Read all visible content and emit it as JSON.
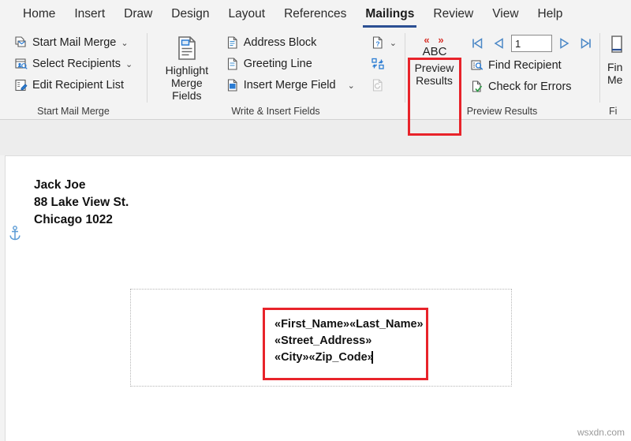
{
  "tabs": [
    {
      "label": "Home",
      "active": false
    },
    {
      "label": "Insert",
      "active": false
    },
    {
      "label": "Draw",
      "active": false
    },
    {
      "label": "Design",
      "active": false
    },
    {
      "label": "Layout",
      "active": false
    },
    {
      "label": "References",
      "active": false
    },
    {
      "label": "Mailings",
      "active": true
    },
    {
      "label": "Review",
      "active": false
    },
    {
      "label": "View",
      "active": false
    },
    {
      "label": "Help",
      "active": false
    }
  ],
  "ribbon": {
    "groups": {
      "start_mail_merge": {
        "label": "Start Mail Merge",
        "commands": [
          {
            "name": "start-mail-merge",
            "label": "Start Mail Merge",
            "icon": "envelope-document-icon",
            "dropdown": true
          },
          {
            "name": "select-recipients",
            "label": "Select Recipients",
            "icon": "recipients-list-icon",
            "dropdown": true
          },
          {
            "name": "edit-recipient-list",
            "label": "Edit Recipient List",
            "icon": "edit-list-icon",
            "dropdown": false
          }
        ]
      },
      "write_insert_fields": {
        "label": "Write & Insert Fields",
        "highlight_button": {
          "name": "highlight-merge-fields",
          "line1": "Highlight",
          "line2": "Merge Fields",
          "icon": "highlight-fields-icon"
        },
        "commands": [
          {
            "name": "address-block",
            "label": "Address Block",
            "icon": "address-block-icon",
            "dropdown": false
          },
          {
            "name": "greeting-line",
            "label": "Greeting Line",
            "icon": "greeting-line-icon",
            "dropdown": false
          },
          {
            "name": "insert-merge-field",
            "label": "Insert Merge Field",
            "icon": "insert-merge-field-icon",
            "dropdown": true
          }
        ],
        "side_commands": [
          {
            "name": "rules",
            "icon": "rules-question-icon",
            "dropdown": true,
            "disabled": false
          },
          {
            "name": "match-fields",
            "icon": "match-fields-icon",
            "dropdown": false,
            "disabled": false
          },
          {
            "name": "update-labels",
            "icon": "update-labels-icon",
            "dropdown": false,
            "disabled": true
          }
        ]
      },
      "preview_results": {
        "label": "Preview Results",
        "highlighted": true,
        "highlight_color": "#e8232a",
        "preview_button": {
          "name": "preview-results",
          "icon": "abc-chevrons-icon",
          "icon_text": "ABC",
          "chevrons_left": "«",
          "chevrons_right": "»",
          "line1": "Preview",
          "line2": "Results"
        },
        "navigation": {
          "first": "first-record-icon",
          "previous": "previous-record-icon",
          "record_number": "1",
          "next": "next-record-icon",
          "last": "last-record-icon"
        },
        "commands": [
          {
            "name": "find-recipient",
            "label": "Find Recipient",
            "icon": "find-recipient-icon"
          },
          {
            "name": "check-for-errors",
            "label": "Check for Errors",
            "icon": "check-for-errors-icon"
          }
        ]
      },
      "finish": {
        "label": "Fi",
        "finish_button": {
          "name": "finish-and-merge",
          "line1": "Fin",
          "line2": "Me",
          "icon": "finish-merge-icon"
        }
      }
    }
  },
  "document": {
    "sender_address": "Jack Joe\n88 Lake View St.\nChicago 1022",
    "anchor_icon": "anchor-icon",
    "merge_fields_text": "«First_Name»«Last_Name»\n«Street_Address»\n«City»«Zip_Code»"
  },
  "watermark": "wsxdn.com"
}
